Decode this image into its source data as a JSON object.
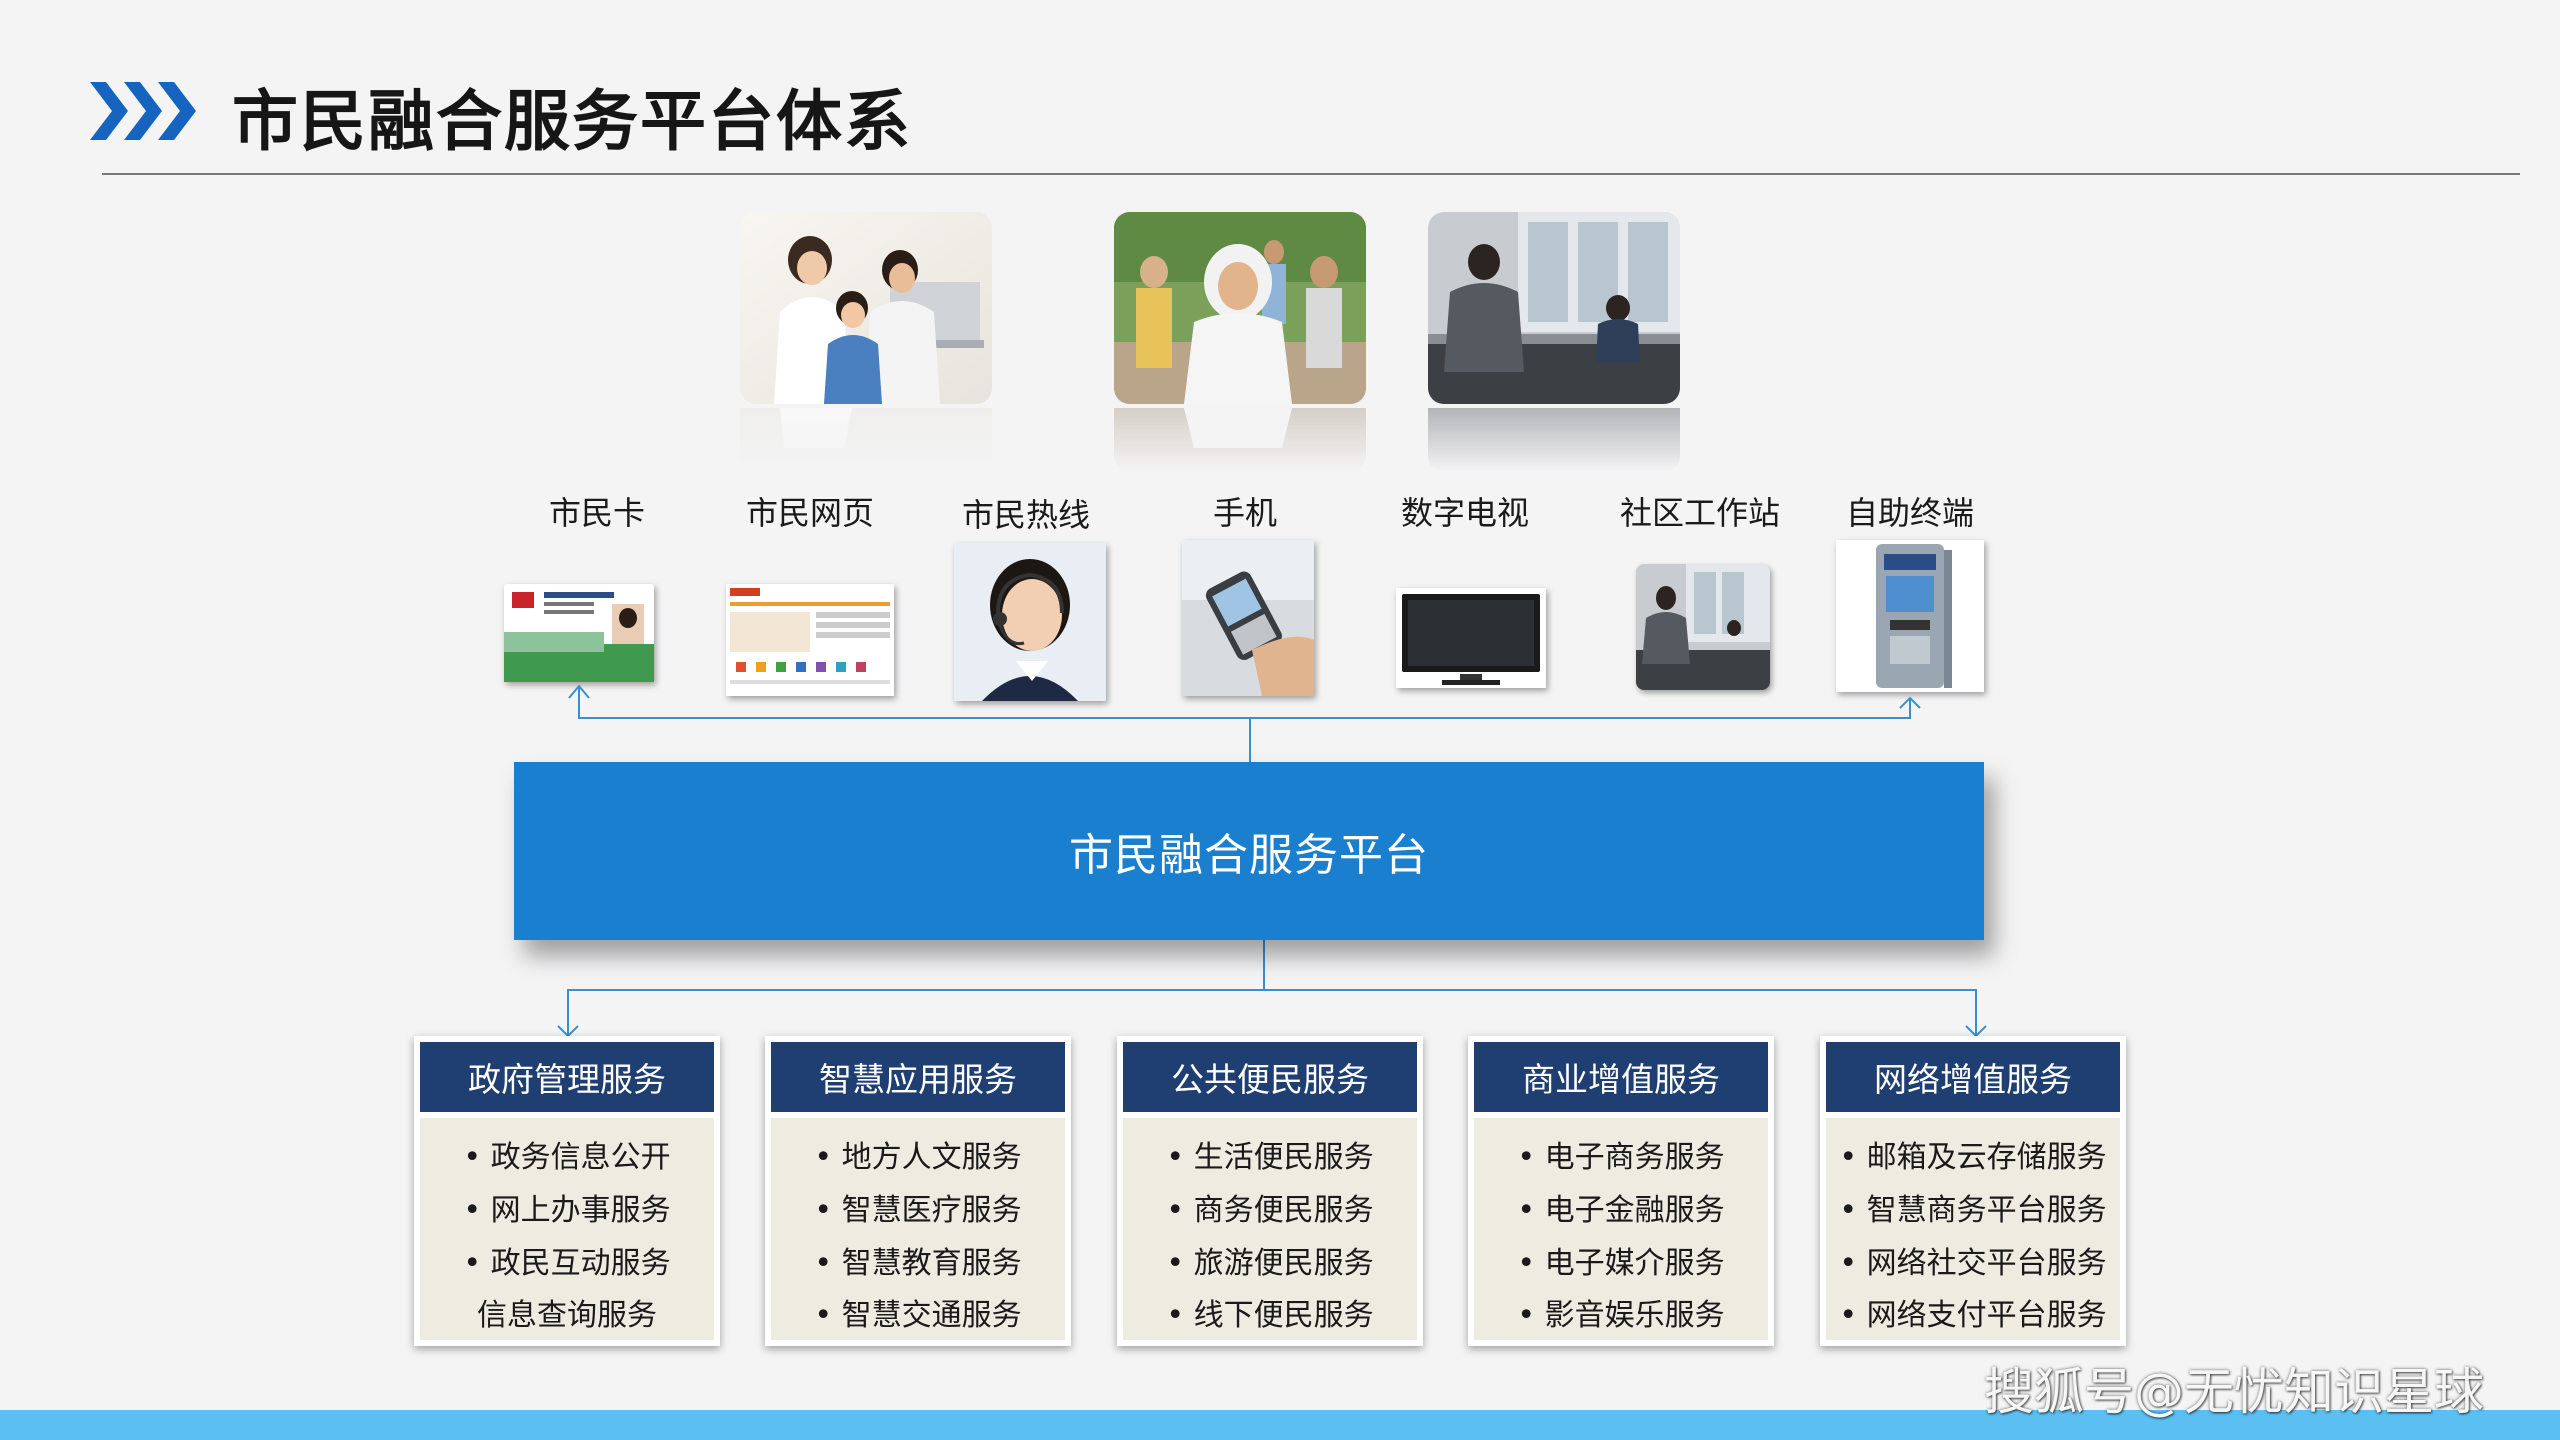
{
  "header": {
    "title": "市民融合服务平台体系"
  },
  "channels": [
    {
      "label": "市民卡"
    },
    {
      "label": "市民网页"
    },
    {
      "label": "市民热线"
    },
    {
      "label": "手机"
    },
    {
      "label": "数字电视"
    },
    {
      "label": "社区工作站"
    },
    {
      "label": "自助终端"
    }
  ],
  "platform": {
    "label": "市民融合服务平台"
  },
  "services": [
    {
      "title": "政府管理服务",
      "items": [
        "• 政务信息公开",
        "• 网上办事服务",
        "• 政民互动服务",
        "信息查询服务"
      ]
    },
    {
      "title": "智慧应用服务",
      "items": [
        "• 地方人文服务",
        "• 智慧医疗服务",
        "• 智慧教育服务",
        "• 智慧交通服务"
      ]
    },
    {
      "title": "公共便民服务",
      "items": [
        "• 生活便民服务",
        "• 商务便民服务",
        "• 旅游便民服务",
        "• 线下便民服务"
      ]
    },
    {
      "title": "商业增值服务",
      "items": [
        "• 电子商务服务",
        "• 电子金融服务",
        "• 电子媒介服务",
        "• 影音娱乐服务"
      ]
    },
    {
      "title": "网络增值服务",
      "items": [
        "• 邮箱及云存储服务",
        "• 智慧商务平台服务",
        "• 网络社交平台服务",
        "•  网络支付平台服务"
      ]
    }
  ],
  "watermark": "搜狐号@无忧知识星球",
  "colors": {
    "accent_blue": "#1a7fcf",
    "header_navy": "#1f3f72",
    "chevron_blue": "#1565c0",
    "body_beige": "#eeece1",
    "footer_bar": "#5cbff2",
    "connector": "#3a8fd0"
  }
}
